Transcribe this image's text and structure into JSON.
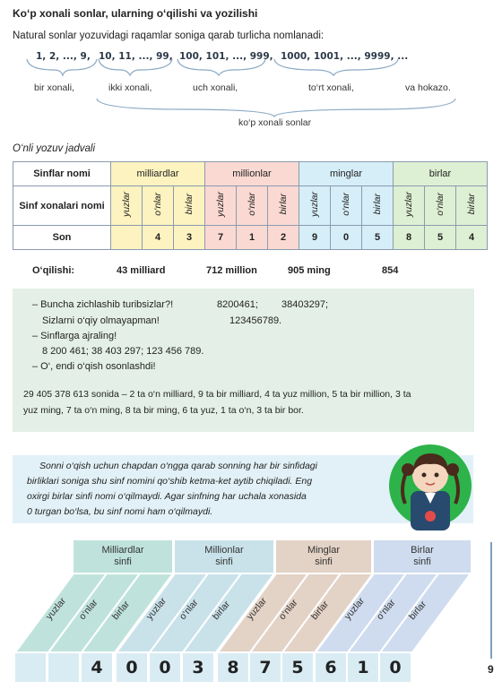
{
  "title": "Ko‘p xonali sonlar, ularning o‘qilishi va yozilishi",
  "intro": "Natural sonlar yozuvidagi raqamlar soniga qarab turlicha nomlanadi:",
  "groups": [
    {
      "numbers": "1,  2,  ...,  9,",
      "label": "bir xonali,"
    },
    {
      "numbers": "10,  11,  ...,  99,",
      "label": "ikki xonali,"
    },
    {
      "numbers": "100,  101,  ...,  999,",
      "label": "uch xonali,"
    },
    {
      "numbers": "1000,  1001,  ...,  9999,  ...",
      "label": "to‘rt xonali,"
    },
    {
      "label": "va hokazo."
    }
  ],
  "multi_digit_label": "ko‘p xonali sonlar",
  "table_title": "O‘nli yozuv jadvali",
  "table": {
    "row1_header": "Sinflar nomi",
    "classes": [
      "milliardlar",
      "millionlar",
      "minglar",
      "birlar"
    ],
    "row2_header": "Sinf xonalari nomi",
    "places": [
      "yuzlar",
      "o‘nlar",
      "birlar"
    ],
    "row3_header": "Son",
    "digits": [
      "",
      "4",
      "3",
      "7",
      "1",
      "2",
      "9",
      "0",
      "5",
      "8",
      "5",
      "4"
    ],
    "colors": {
      "billions": "#fdf3c0",
      "millions": "#fbd9d3",
      "thousands": "#d6eef8",
      "units": "#def0d3"
    }
  },
  "reading": {
    "label": "O‘qilishi:",
    "parts": [
      "43 milliard",
      "712 million",
      "905 ming",
      "854"
    ]
  },
  "dialogue": {
    "line1_a": "–  Buncha zichlashib turibsizlar?!",
    "line1_b": "8200461;",
    "line1_c": "38403297;",
    "line2_a": "Sizlarni o‘qiy olmayapman!",
    "line2_b": "123456789.",
    "line3": "–  Sinflarga ajraling!",
    "line4": "8 200 461;   38 403 297;   123 456 789.",
    "line5": "–  O‘, endi o‘qish osonlashdi!",
    "example_line1": "29 405 378 613 sonida – 2 ta o‘n milliard, 9 ta bir milliard, 4 ta yuz million, 5 ta bir million,  3 ta",
    "example_line2": "yuz ming, 7 ta o‘n ming, 8 ta bir ming, 6 ta yuz, 1 ta o‘n, 3 ta bir bor."
  },
  "rule": {
    "line1": "Sonni o‘qish uchun chapdan o‘ngga qarab sonning har bir sinfidagi",
    "line2": "birliklari soniga shu sinf nomini qo‘shib ketma-ket aytib chiqiladi. Eng",
    "line3": "oxirgi birlar sinfi nomi o‘qilmaydi. Agar sinfning har uchala xonasida",
    "line4": "0 turgan bo‘lsa, bu sinf nomi  ham o‘qilmaydi."
  },
  "class_headers": [
    {
      "line1": "Milliardlar",
      "line2": "sinfi",
      "color": "#bfe3dc"
    },
    {
      "line1": "Millionlar",
      "line2": "sinfi",
      "color": "#c9e2ea"
    },
    {
      "line1": "Minglar",
      "line2": "sinfi",
      "color": "#e3d2c6"
    },
    {
      "line1": "Birlar",
      "line2": "sinfi",
      "color": "#cfdcef"
    }
  ],
  "diag_labels": [
    "yuzlar",
    "o‘nlar",
    "birlar",
    "yuzlar",
    "o‘nlar",
    "birlar",
    "yuzlar",
    "o‘nlar",
    "birlar",
    "yuzlar",
    "o‘nlar",
    "birlar"
  ],
  "bottom_digits": [
    "",
    "",
    "4",
    "0",
    "0",
    "3",
    "8",
    "7",
    "5",
    "6",
    "1",
    "0"
  ],
  "page_number": "9"
}
